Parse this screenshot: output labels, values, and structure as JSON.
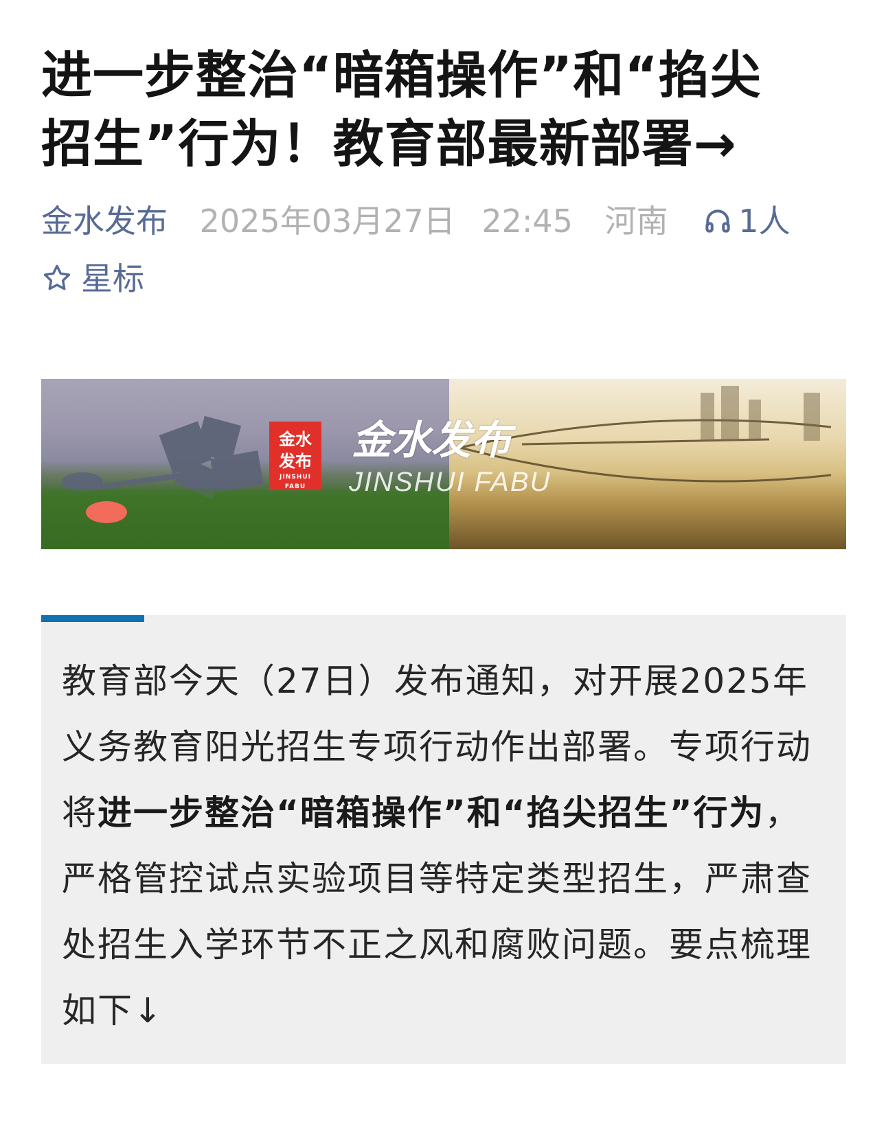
{
  "article": {
    "title": "进一步整治“暗箱操作”和“掐尖招生”行为！教育部最新部署→",
    "meta": {
      "author": "金水发布",
      "date": "2025年03月27日",
      "time": "22:45",
      "region": "河南",
      "listen_count": "1人",
      "listen_icon": "headphones-icon",
      "star_label": "星标",
      "star_icon": "star-outline-icon"
    },
    "banner": {
      "logo_line1": "金水",
      "logo_line2": "发布",
      "logo_pinyin": "JINSHUI FABU",
      "brand_name": "金水发布",
      "brand_en": "JINSHUI FABU"
    },
    "summary": {
      "accent_color": "#1171b4",
      "part1": "教育部今天（27日）发布通知，对开展2025年义务教育阳光招生专项行动作出部署。专项行动将",
      "bold": "进一步整治“暗箱操作”和“掐尖招生”行为",
      "part2": "，严格管控试点实验项目等特定类型招生，严肃查处招生入学环节不正之风和腐败问题。要点梳理如下↓"
    }
  }
}
